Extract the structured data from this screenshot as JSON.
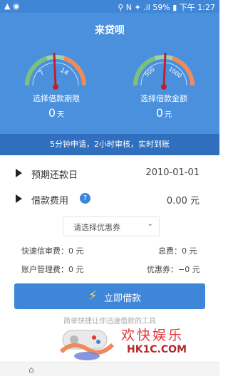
{
  "status_bar": {
    "left_icons": "▲ ◉",
    "right_text": "⚲ N ✦ .il 59% ▮ 下午 1:27"
  },
  "header": {
    "title": "来贷呗",
    "left_gauge": {
      "ticks": [
        "7",
        "14"
      ],
      "label": "选择借款期限",
      "value": "0",
      "unit": "天"
    },
    "right_gauge": {
      "ticks": [
        "500",
        "1000"
      ],
      "label": "选择借款金额",
      "value": "0",
      "unit": "元"
    }
  },
  "banner": "5分钟申请，2小时审核，实时到账",
  "repayment_row": {
    "label": "预期还款日",
    "value": "2010-01-01"
  },
  "fee_row": {
    "label": "借款费用",
    "help": "?",
    "value": "0.00 元"
  },
  "coupon_select": {
    "placeholder": "请选择优惠券",
    "chevron": "⌄"
  },
  "fees": {
    "credit_review": "快速信审费：0 元",
    "interest": "息费：0 元",
    "account_mgmt": "账户管理费：0 元",
    "coupon": "优惠券：−0 元"
  },
  "borrow_button": {
    "icon": "⚡",
    "label": "立即借款"
  },
  "slogan": "简单快捷让你迅速借款的工具",
  "watermark": {
    "text": "欢快娱乐",
    "url": "HK1C.COM"
  },
  "colors": {
    "header": "#4a90dd",
    "banner": "#2f6fbd",
    "button": "#3e86d8",
    "needle": "#c0202a"
  },
  "icons": [
    "signal-icon",
    "battery-icon",
    "gauge-icon",
    "help-icon",
    "lightning-icon",
    "chevron-down-icon",
    "gamepad-logo"
  ]
}
